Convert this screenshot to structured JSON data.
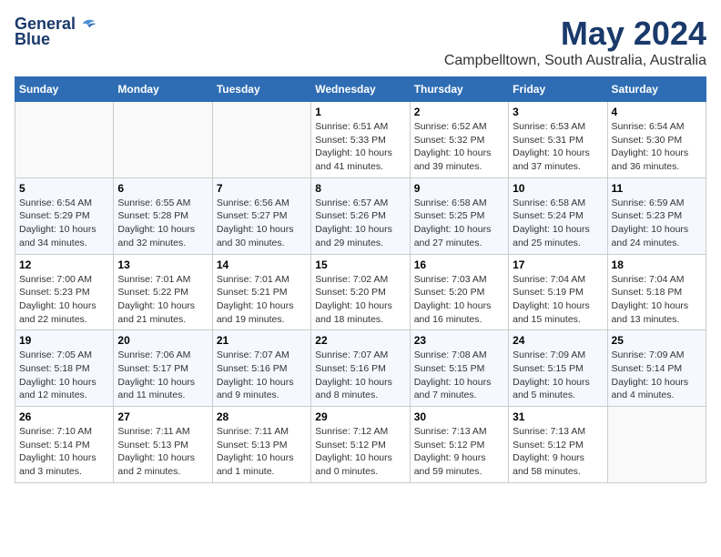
{
  "header": {
    "logo_line1": "General",
    "logo_line2": "Blue",
    "month_year": "May 2024",
    "location": "Campbelltown, South Australia, Australia"
  },
  "days_of_week": [
    "Sunday",
    "Monday",
    "Tuesday",
    "Wednesday",
    "Thursday",
    "Friday",
    "Saturday"
  ],
  "weeks": [
    {
      "days": [
        {
          "num": "",
          "info": ""
        },
        {
          "num": "",
          "info": ""
        },
        {
          "num": "",
          "info": ""
        },
        {
          "num": "1",
          "info": "Sunrise: 6:51 AM\nSunset: 5:33 PM\nDaylight: 10 hours\nand 41 minutes."
        },
        {
          "num": "2",
          "info": "Sunrise: 6:52 AM\nSunset: 5:32 PM\nDaylight: 10 hours\nand 39 minutes."
        },
        {
          "num": "3",
          "info": "Sunrise: 6:53 AM\nSunset: 5:31 PM\nDaylight: 10 hours\nand 37 minutes."
        },
        {
          "num": "4",
          "info": "Sunrise: 6:54 AM\nSunset: 5:30 PM\nDaylight: 10 hours\nand 36 minutes."
        }
      ]
    },
    {
      "days": [
        {
          "num": "5",
          "info": "Sunrise: 6:54 AM\nSunset: 5:29 PM\nDaylight: 10 hours\nand 34 minutes."
        },
        {
          "num": "6",
          "info": "Sunrise: 6:55 AM\nSunset: 5:28 PM\nDaylight: 10 hours\nand 32 minutes."
        },
        {
          "num": "7",
          "info": "Sunrise: 6:56 AM\nSunset: 5:27 PM\nDaylight: 10 hours\nand 30 minutes."
        },
        {
          "num": "8",
          "info": "Sunrise: 6:57 AM\nSunset: 5:26 PM\nDaylight: 10 hours\nand 29 minutes."
        },
        {
          "num": "9",
          "info": "Sunrise: 6:58 AM\nSunset: 5:25 PM\nDaylight: 10 hours\nand 27 minutes."
        },
        {
          "num": "10",
          "info": "Sunrise: 6:58 AM\nSunset: 5:24 PM\nDaylight: 10 hours\nand 25 minutes."
        },
        {
          "num": "11",
          "info": "Sunrise: 6:59 AM\nSunset: 5:23 PM\nDaylight: 10 hours\nand 24 minutes."
        }
      ]
    },
    {
      "days": [
        {
          "num": "12",
          "info": "Sunrise: 7:00 AM\nSunset: 5:23 PM\nDaylight: 10 hours\nand 22 minutes."
        },
        {
          "num": "13",
          "info": "Sunrise: 7:01 AM\nSunset: 5:22 PM\nDaylight: 10 hours\nand 21 minutes."
        },
        {
          "num": "14",
          "info": "Sunrise: 7:01 AM\nSunset: 5:21 PM\nDaylight: 10 hours\nand 19 minutes."
        },
        {
          "num": "15",
          "info": "Sunrise: 7:02 AM\nSunset: 5:20 PM\nDaylight: 10 hours\nand 18 minutes."
        },
        {
          "num": "16",
          "info": "Sunrise: 7:03 AM\nSunset: 5:20 PM\nDaylight: 10 hours\nand 16 minutes."
        },
        {
          "num": "17",
          "info": "Sunrise: 7:04 AM\nSunset: 5:19 PM\nDaylight: 10 hours\nand 15 minutes."
        },
        {
          "num": "18",
          "info": "Sunrise: 7:04 AM\nSunset: 5:18 PM\nDaylight: 10 hours\nand 13 minutes."
        }
      ]
    },
    {
      "days": [
        {
          "num": "19",
          "info": "Sunrise: 7:05 AM\nSunset: 5:18 PM\nDaylight: 10 hours\nand 12 minutes."
        },
        {
          "num": "20",
          "info": "Sunrise: 7:06 AM\nSunset: 5:17 PM\nDaylight: 10 hours\nand 11 minutes."
        },
        {
          "num": "21",
          "info": "Sunrise: 7:07 AM\nSunset: 5:16 PM\nDaylight: 10 hours\nand 9 minutes."
        },
        {
          "num": "22",
          "info": "Sunrise: 7:07 AM\nSunset: 5:16 PM\nDaylight: 10 hours\nand 8 minutes."
        },
        {
          "num": "23",
          "info": "Sunrise: 7:08 AM\nSunset: 5:15 PM\nDaylight: 10 hours\nand 7 minutes."
        },
        {
          "num": "24",
          "info": "Sunrise: 7:09 AM\nSunset: 5:15 PM\nDaylight: 10 hours\nand 5 minutes."
        },
        {
          "num": "25",
          "info": "Sunrise: 7:09 AM\nSunset: 5:14 PM\nDaylight: 10 hours\nand 4 minutes."
        }
      ]
    },
    {
      "days": [
        {
          "num": "26",
          "info": "Sunrise: 7:10 AM\nSunset: 5:14 PM\nDaylight: 10 hours\nand 3 minutes."
        },
        {
          "num": "27",
          "info": "Sunrise: 7:11 AM\nSunset: 5:13 PM\nDaylight: 10 hours\nand 2 minutes."
        },
        {
          "num": "28",
          "info": "Sunrise: 7:11 AM\nSunset: 5:13 PM\nDaylight: 10 hours\nand 1 minute."
        },
        {
          "num": "29",
          "info": "Sunrise: 7:12 AM\nSunset: 5:12 PM\nDaylight: 10 hours\nand 0 minutes."
        },
        {
          "num": "30",
          "info": "Sunrise: 7:13 AM\nSunset: 5:12 PM\nDaylight: 9 hours\nand 59 minutes."
        },
        {
          "num": "31",
          "info": "Sunrise: 7:13 AM\nSunset: 5:12 PM\nDaylight: 9 hours\nand 58 minutes."
        },
        {
          "num": "",
          "info": ""
        }
      ]
    }
  ]
}
